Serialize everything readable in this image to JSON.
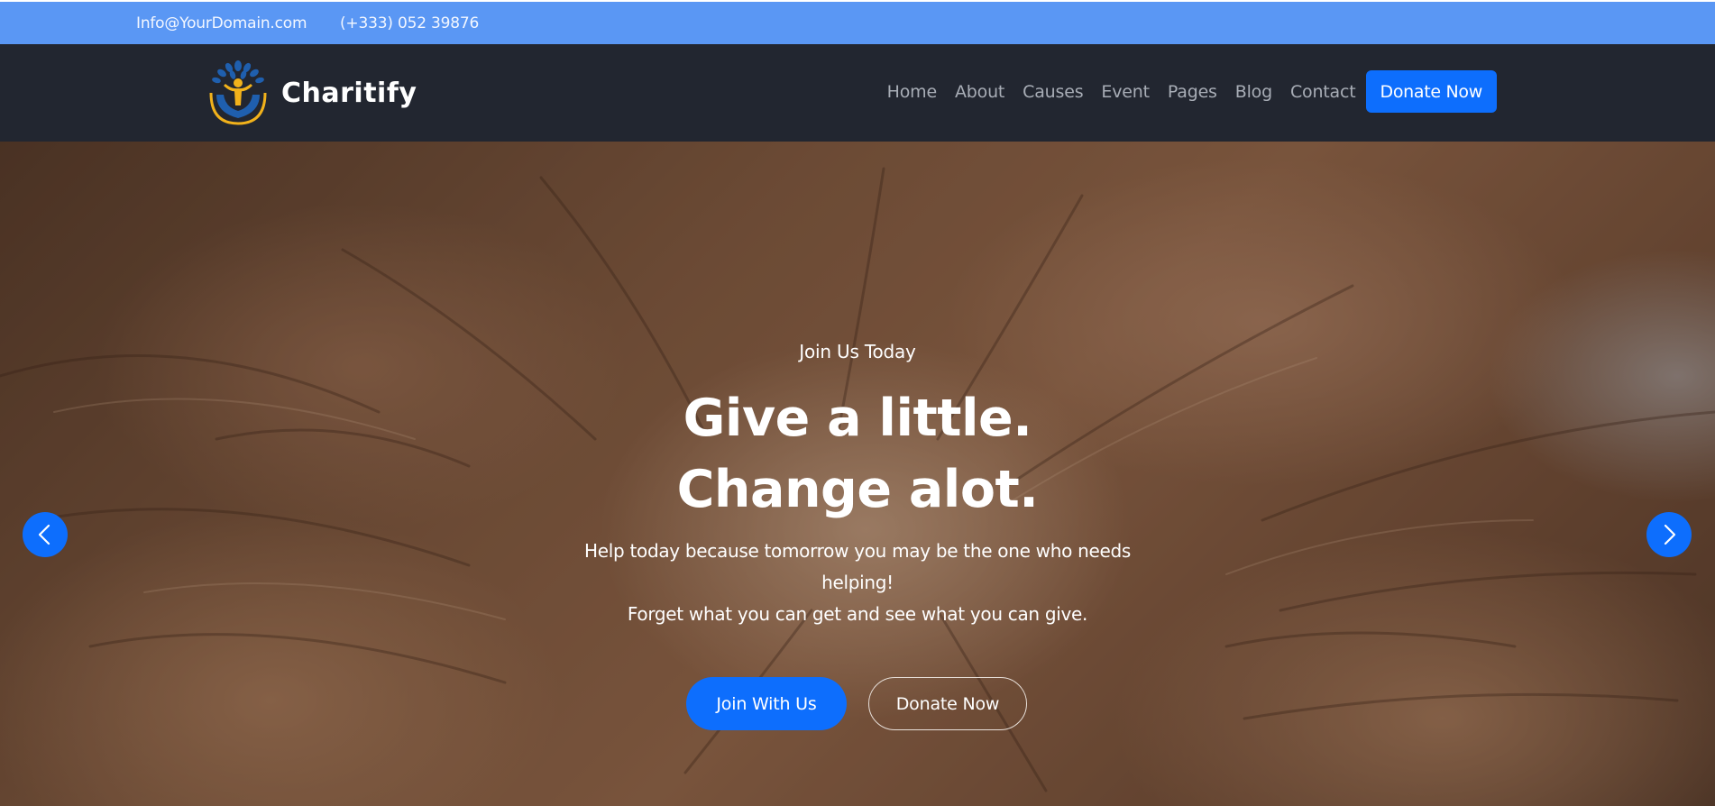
{
  "topbar": {
    "email": "Info@YourDomain.com",
    "phone": "(+333) 052 39876",
    "background": "#5a97f4"
  },
  "navbar": {
    "brand": "Charitify",
    "logo_icon": "charity-logo-icon",
    "items": [
      {
        "label": "Home"
      },
      {
        "label": "About"
      },
      {
        "label": "Causes"
      },
      {
        "label": "Event"
      },
      {
        "label": "Pages"
      },
      {
        "label": "Blog"
      },
      {
        "label": "Contact"
      }
    ],
    "donate_label": "Donate Now",
    "background": "#222630"
  },
  "hero": {
    "eyebrow": "Join Us Today",
    "headline": "Give a little. Change alot.",
    "subtext_line1": "Help today because tomorrow you may be the one who needs helping!",
    "subtext_line2": "Forget what you can get and see what you can give.",
    "primary_button": "Join With Us",
    "secondary_button": "Donate Now",
    "prev_icon": "chevron-left-icon",
    "next_icon": "chevron-right-icon"
  },
  "colors": {
    "accent": "#0d6efd",
    "text_on_dark": "#ffffff",
    "nav_text": "#a8adb6"
  }
}
